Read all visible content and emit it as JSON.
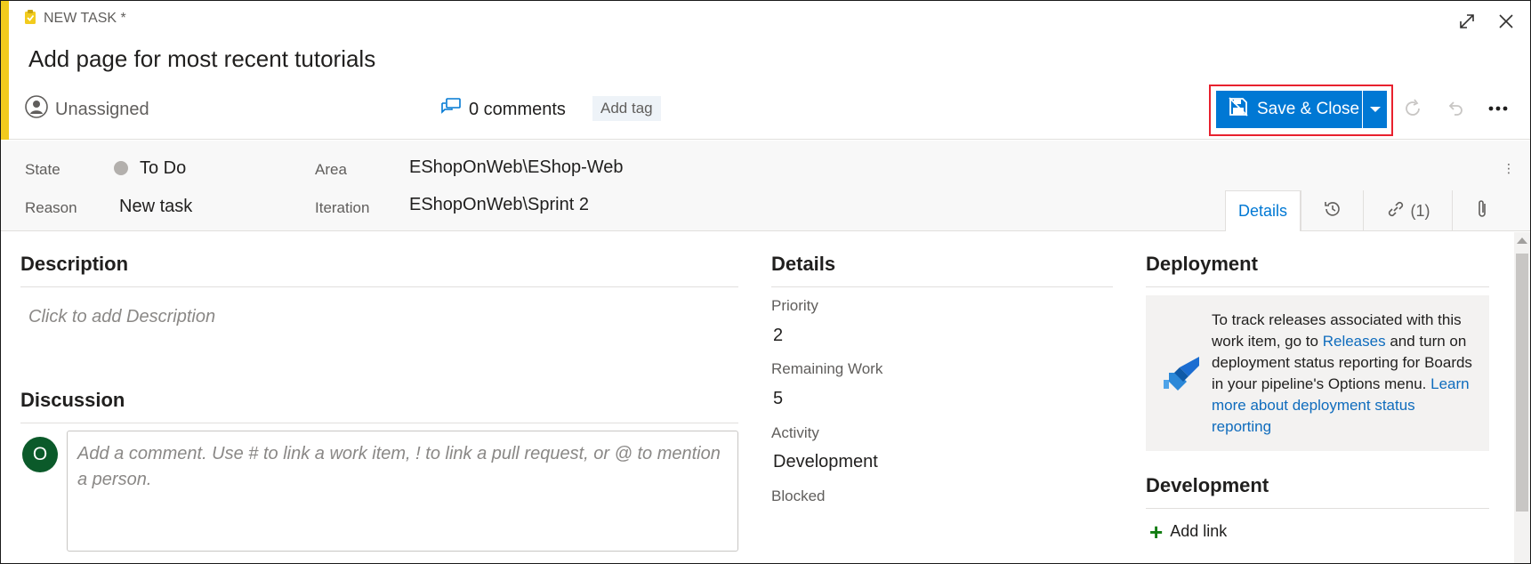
{
  "header": {
    "work_item_type": "NEW TASK *",
    "title": "Add page for most recent tutorials",
    "assignee": "Unassigned",
    "comments": "0 comments",
    "add_tag": "Add tag",
    "save_close": "Save & Close"
  },
  "fields": {
    "state_label": "State",
    "state_value": "To Do",
    "reason_label": "Reason",
    "reason_value": "New task",
    "area_label": "Area",
    "area_value": "EShopOnWeb\\EShop-Web",
    "iteration_label": "Iteration",
    "iteration_value": "EShopOnWeb\\Sprint 2"
  },
  "tabs": {
    "details": "Details",
    "links_count": "(1)"
  },
  "description": {
    "title": "Description",
    "placeholder": "Click to add Description"
  },
  "discussion": {
    "title": "Discussion",
    "avatar_initial": "O",
    "placeholder": "Add a comment. Use # to link a work item, ! to link a pull request, or @ to mention a person."
  },
  "details": {
    "title": "Details",
    "priority_label": "Priority",
    "priority_value": "2",
    "remaining_label": "Remaining Work",
    "remaining_value": "5",
    "activity_label": "Activity",
    "activity_value": "Development",
    "blocked_label": "Blocked"
  },
  "deployment": {
    "title": "Deployment",
    "text_1": "To track releases associated with this work item, go to ",
    "releases_link": "Releases",
    "text_2": " and turn on deployment status reporting for Boards in your pipeline's Options menu. ",
    "learn_more_link": "Learn more about deployment status reporting"
  },
  "development": {
    "title": "Development",
    "add_link": "Add link"
  },
  "colors": {
    "accent": "#0078d4",
    "task_yellow": "#f2cb1d",
    "highlight_red": "#e8212e",
    "avatar_green": "#0b5a2a"
  },
  "icons": [
    "task-icon",
    "expand-icon",
    "close-icon",
    "person-icon",
    "comment-icon",
    "save-icon",
    "refresh-icon",
    "undo-icon",
    "more-icon",
    "history-icon",
    "link-icon",
    "attachment-icon",
    "pipeline-icon",
    "plus-icon"
  ]
}
